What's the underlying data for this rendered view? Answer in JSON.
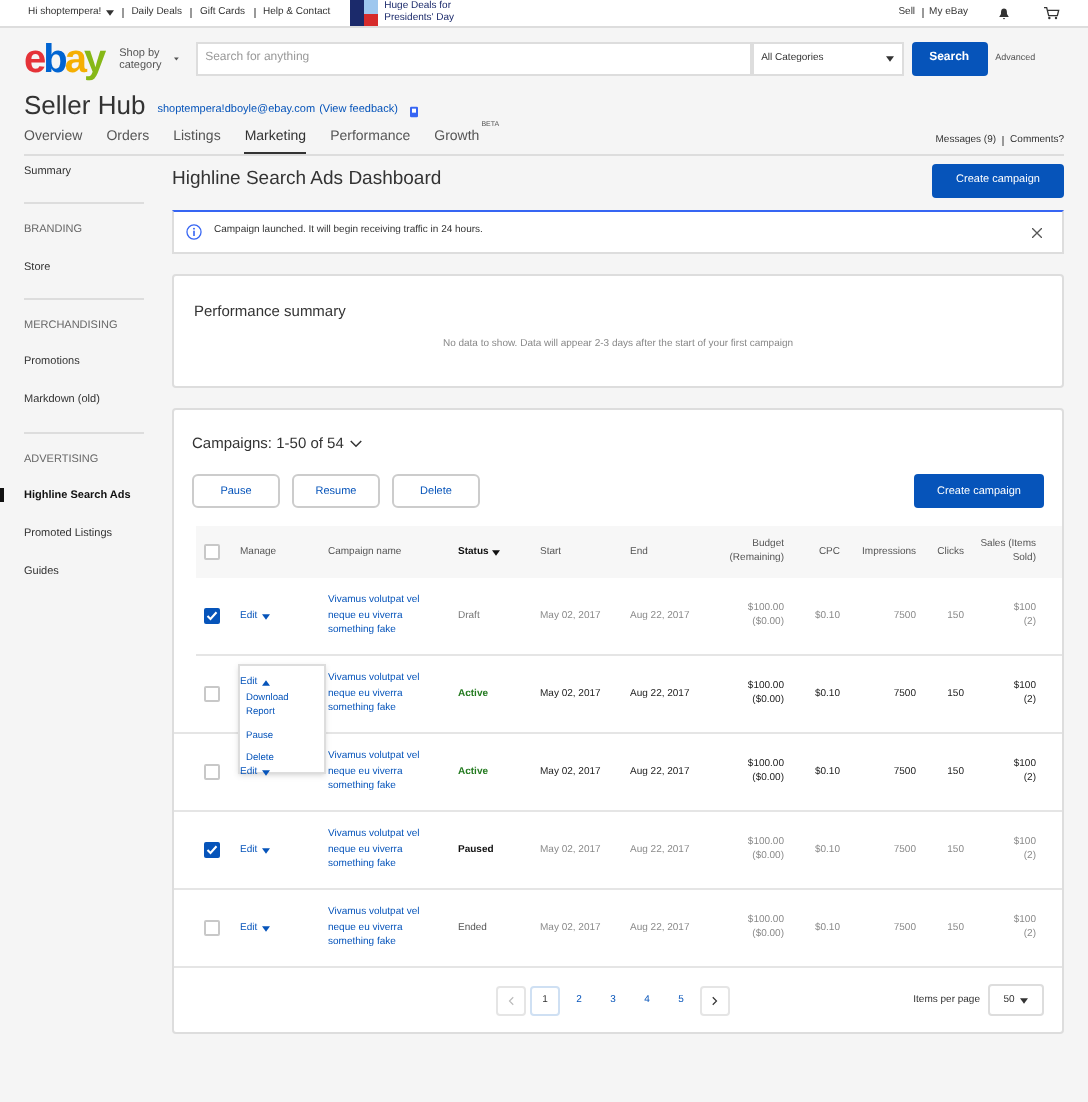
{
  "top_bar": {
    "greeting": "Hi shoptempera!",
    "links": [
      "Daily Deals",
      "Gift Cards",
      "Help & Contact"
    ],
    "promo": "Huge Deals for Presidents' Day",
    "right_links": [
      "Sell",
      "My eBay"
    ]
  },
  "header": {
    "logo": [
      {
        "text": "e",
        "color": "#e53238"
      },
      {
        "text": "b",
        "color": "#0064d2"
      },
      {
        "text": "a",
        "color": "#f5af02"
      },
      {
        "text": "y",
        "color": "#86b817"
      }
    ],
    "shop_by": "Shop by category",
    "search_placeholder": "Search for anything",
    "category": "All Categories",
    "search_button": "Search",
    "advanced": "Advanced"
  },
  "hub": {
    "title": "Seller Hub",
    "email": "shoptempera!dboyle@ebay.com",
    "feedback": "(View feedback)"
  },
  "tabs": [
    {
      "label": "Overview",
      "selected": false
    },
    {
      "label": "Orders",
      "selected": false
    },
    {
      "label": "Listings",
      "selected": false
    },
    {
      "label": "Marketing",
      "selected": true
    },
    {
      "label": "Performance",
      "selected": false
    },
    {
      "label": "Growth",
      "badge": "BETA",
      "selected": false
    }
  ],
  "tab_links": [
    "Messages (9)",
    "Comments?"
  ],
  "sidebar": [
    {
      "kind": "item",
      "label": "Summary",
      "selected": false
    },
    {
      "kind": "heading",
      "label": "BRANDING"
    },
    {
      "kind": "item",
      "label": "Store",
      "selected": false
    },
    {
      "kind": "heading",
      "label": "MERCHANDISING"
    },
    {
      "kind": "item",
      "label": "Promotions",
      "selected": false
    },
    {
      "kind": "item",
      "label": "Markdown (old)",
      "selected": false
    },
    {
      "kind": "heading",
      "label": "ADVERTISING"
    },
    {
      "kind": "item",
      "label": "Highline Search Ads",
      "selected": true
    },
    {
      "kind": "item",
      "label": "Promoted Listings",
      "selected": false
    },
    {
      "kind": "item",
      "label": "Guides",
      "selected": false
    }
  ],
  "page_title": "Highline Search Ads Dashboard",
  "create_button": "Create campaign",
  "notice": "Campaign launched. It will begin receiving traffic in 24 hours.",
  "performance": {
    "title": "Performance summary",
    "empty": "No data to show. Data will appear 2-3 days after the start of your first campaign"
  },
  "campaigns": {
    "title": "Campaigns: 1-50 of 54",
    "actions": [
      "Pause",
      "Resume",
      "Delete"
    ],
    "create_button": "Create campaign",
    "select_all_checked": false,
    "columns": [
      "Manage",
      "Campaign name",
      "Status",
      "Start",
      "End",
      "Budget (Remaining)",
      "CPC",
      "Impressions",
      "Clicks",
      "Sales (Items Sold)"
    ],
    "rows": [
      {
        "checked": true,
        "edit": "Edit",
        "name": "Vivamus volutpat vel neque eu viverra something fake",
        "status": "Draft",
        "kind": "draft",
        "start": "May 02, 2017",
        "end": "Aug 22, 2017",
        "budget": "$100.00",
        "remaining": "($0.00)",
        "cpc": "$0.10",
        "impressions": "7500",
        "clicks": "150",
        "sales": "$100",
        "items": "(2)",
        "menu_open": false
      },
      {
        "checked": false,
        "edit": "Edit",
        "name": "Vivamus volutpat vel neque eu viverra something fake",
        "status": "Active",
        "kind": "active",
        "start": "May 02, 2017",
        "end": "Aug 22, 2017",
        "budget": "$100.00",
        "remaining": "($0.00)",
        "cpc": "$0.10",
        "impressions": "7500",
        "clicks": "150",
        "sales": "$100",
        "items": "(2)",
        "menu_open": true,
        "menu": [
          "Download Report",
          "Pause",
          "Delete"
        ]
      },
      {
        "checked": false,
        "edit": "Edit",
        "name": "Vivamus volutpat vel neque eu viverra something fake",
        "status": "Active",
        "kind": "active",
        "start": "May 02, 2017",
        "end": "Aug 22, 2017",
        "budget": "$100.00",
        "remaining": "($0.00)",
        "cpc": "$0.10",
        "impressions": "7500",
        "clicks": "150",
        "sales": "$100",
        "items": "(2)",
        "menu_open": false
      },
      {
        "checked": true,
        "edit": "Edit",
        "name": "Vivamus volutpat vel neque eu viverra something fake",
        "status": "Paused",
        "kind": "paused",
        "start": "May 02, 2017",
        "end": "Aug 22, 2017",
        "budget": "$100.00",
        "remaining": "($0.00)",
        "cpc": "$0.10",
        "impressions": "7500",
        "clicks": "150",
        "sales": "$100",
        "items": "(2)",
        "menu_open": false
      },
      {
        "checked": false,
        "edit": "Edit",
        "name": "Vivamus volutpat vel neque eu viverra something fake",
        "status": "Ended",
        "kind": "ended",
        "start": "May 02, 2017",
        "end": "Aug 22, 2017",
        "budget": "$100.00",
        "remaining": "($0.00)",
        "cpc": "$0.10",
        "impressions": "7500",
        "clicks": "150",
        "sales": "$100",
        "items": "(2)",
        "menu_open": false
      }
    ],
    "pages": [
      {
        "label": "1",
        "selected": true
      },
      {
        "label": "2",
        "selected": false
      },
      {
        "label": "3",
        "selected": false
      },
      {
        "label": "4",
        "selected": false
      },
      {
        "label": "5",
        "selected": false
      }
    ],
    "per_page_label": "Items per page",
    "per_page": "50"
  }
}
